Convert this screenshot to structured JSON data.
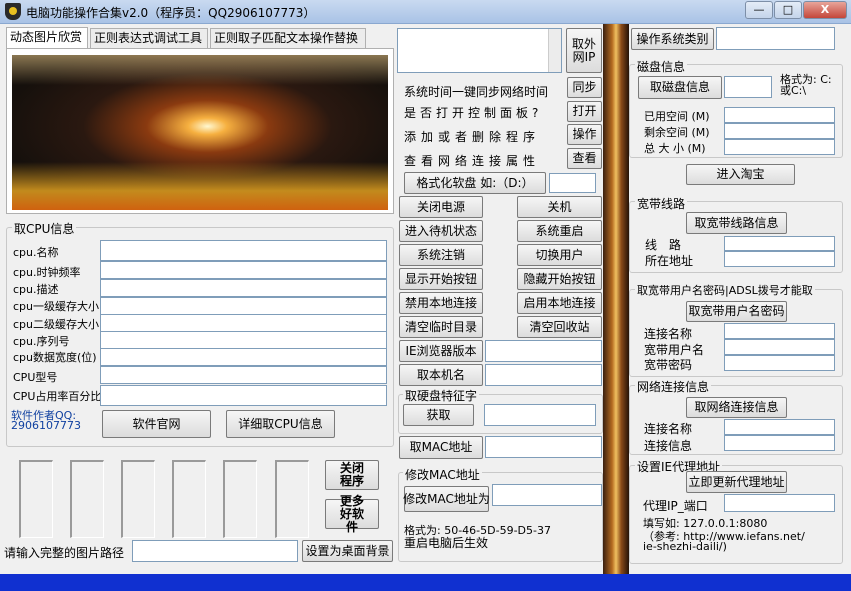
{
  "window": {
    "title": "电脑功能操作合集v2.0（程序员：QQ2906107773）",
    "minimize": "—",
    "maximize": "□",
    "close": "X"
  },
  "tabs": [
    "动态图片欣赏",
    "正则表达式调试工具",
    "正则取子匹配文本操作替换"
  ],
  "cpu": {
    "group_title": "取CPU信息",
    "labels": [
      "cpu.名称",
      "cpu.时钟频率",
      "cpu.描述",
      "cpu一级缓存大小",
      "cpu二级缓存大小",
      "cpu.序列号",
      "cpu数据宽度(位)",
      "CPU型号",
      "CPU占用率百分比"
    ],
    "author_label": "软件作者QQ:",
    "author_qq": "2906107773",
    "website_button": "软件官网",
    "detail_button": "详细取CPU信息"
  },
  "image_panel": {
    "close_button": "关闭程序",
    "more_button": "更多好软件",
    "path_label": "请输入完整的图片路径",
    "path_value": "",
    "set_wallpaper_button": "设置为桌面背景"
  },
  "middle": {
    "extranet_button": "取外网IP",
    "sync_label": "系统时间一键同步网络时间",
    "sync_button": "同步",
    "ctrl_label": "是否打开控制面板?",
    "ctrl_button": "打开",
    "prog_label": "添加或者删除程序",
    "prog_button": "操作",
    "net_label": "查看网络连接属性",
    "net_button": "查看",
    "format_button": "格式化软盘 如:（D:）",
    "buttons": [
      [
        "关闭电源",
        "关机"
      ],
      [
        "进入待机状态",
        "系统重启"
      ],
      [
        "系统注销",
        "切换用户"
      ],
      [
        "显示开始按钮",
        "隐藏开始按钮"
      ],
      [
        "禁用本地连接",
        "启用本地连接"
      ],
      [
        "清空临时目录",
        "清空回收站"
      ]
    ],
    "ie_button": "IE浏览器版本",
    "host_button": "取本机名",
    "disk_group": "取硬盘特征字",
    "disk_button": "获取",
    "mac_button": "取MAC地址",
    "mac_group": "修改MAC地址",
    "mac_change_button": "修改MAC地址为",
    "mac_format": "格式为: 50-46-5D-59-D5-37",
    "mac_note": "重启电脑后生效"
  },
  "right": {
    "os_button": "操作系统类别",
    "disk": {
      "group": "磁盘信息",
      "button": "取磁盘信息",
      "format_hint": "格式为: C: 或C:\\",
      "used": "已用空间 (M)",
      "free": "剩余空间 (M)",
      "total": "总 大 小 (M)"
    },
    "taobao_button": "进入淘宝",
    "broadband": {
      "group": "宽带线路",
      "button": "取宽带线路信息",
      "line": "线 路",
      "location": "所在地址"
    },
    "password": {
      "group": "取宽带用户名密码|ADSL拨号才能取",
      "button": "取宽带用户名密码",
      "conn_name": "连接名称",
      "user": "宽带用户名",
      "pass": "宽带密码"
    },
    "netconn": {
      "group": "网络连接信息",
      "button": "取网络连接信息",
      "conn_name": "连接名称",
      "conn_info": "连接信息"
    },
    "proxy": {
      "group": "设置IE代理地址",
      "button": "立即更新代理地址",
      "port_label": "代理IP_端口",
      "example": "填写如: 127.0.0.1:8080",
      "ref1": "（参考: http://www.iefans.net/",
      "ref2": "ie-shezhi-daili/)"
    }
  }
}
